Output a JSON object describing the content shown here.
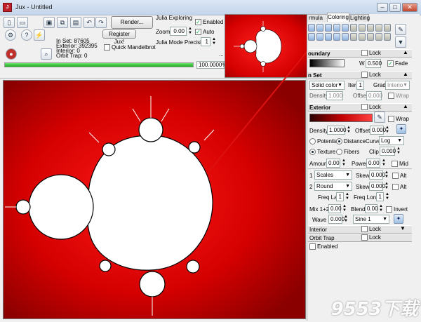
{
  "window": {
    "title": "Jux - Untitled",
    "app_icon_label": "J"
  },
  "toolbar": {
    "render_label": "Render...",
    "register_label": "Register Jux!",
    "quick_mandelbrot_label": "Quick Mandelbrot",
    "quick_mandelbrot_checked": false
  },
  "stats": {
    "in_set": "In Set: 87605",
    "exterior": "Exterior: 392395",
    "interior": "Interior: 0",
    "orbit_trap": "Orbit Trap: 0"
  },
  "progress": {
    "label": "100.0000%",
    "fraction": 1.0
  },
  "julia": {
    "title": "Julia Exploring",
    "enabled_label": "Enabled",
    "enabled_checked": true,
    "zoom_label": "Zoom",
    "zoom_value": "0.00",
    "auto_label": "Auto",
    "auto_checked": true,
    "precision_label": "Julia Mode Precision",
    "precision_value": "1",
    "ellipsis": "..."
  },
  "panel": {
    "tabs": [
      "rmula",
      "Coloring",
      "Lighting"
    ],
    "active_tab": "Coloring",
    "boundary": {
      "title": "oundary",
      "lock_label": "Lock",
      "w_label": "W",
      "w_value": "0.500",
      "fade_label": "Fade",
      "fade_checked": true
    },
    "inset": {
      "title": "n Set",
      "lock_label": "Lock",
      "mode": "Solid color",
      "iter_label": "Iter",
      "iter_value": "1",
      "grad_label": "Grad",
      "grad_value": "Interio",
      "density_label": "Density",
      "density_value": "1.000",
      "offset_label": "Offset",
      "offset_value": "0.000",
      "wrap_label": "Wrap"
    },
    "exterior": {
      "title": "Exterior",
      "lock_label": "Lock",
      "wrap_label": "Wrap",
      "density_label": "Density",
      "density_value": "1.0000",
      "offset_label": "Offset",
      "offset_value": "0.000",
      "potential_label": "Potential",
      "distance_label": "Distance",
      "curve_label": "Curve",
      "curve_value": "Log",
      "texture_label": "Texture",
      "fibers_label": "Fibers",
      "clip_label": "Clip",
      "clip_value": "0.000",
      "amount_label": "Amount",
      "amount_value": "0.00",
      "power_label": "Power",
      "power_value": "0.00",
      "mid_label": "Mid",
      "row1_index": "1",
      "row1_mode": "Scales",
      "row1_skew_label": "Skew",
      "row1_skew_value": "0.000",
      "row1_alt_label": "Alt",
      "row2_index": "2",
      "row2_mode": "Round",
      "row2_skew_label": "Skew",
      "row2_skew_value": "0.000",
      "row2_alt_label": "Alt",
      "freqlat_label": "Freq Lat",
      "freqlat_value": "1",
      "freqlong_label": "Freq Long",
      "freqlong_value": "1",
      "mix_label": "Mix 1+2",
      "mix_value": "0.00",
      "blend_label": "Blend",
      "blend_value": "0.00",
      "invert_label": "Invert",
      "wave_label": "Wave",
      "wave_value": "0.000",
      "wave_mode": "Sine 1"
    },
    "interior": {
      "title": "Interior",
      "lock_label": "Lock"
    },
    "orbit_trap": {
      "title": "Orbit Trap",
      "lock_label": "Lock"
    },
    "enabled_label": "Enabled"
  },
  "colors": {
    "fractal_red": "#d40000",
    "set_white": "#ffffff",
    "arrow": "#dd1111"
  },
  "watermark": "9553下载"
}
